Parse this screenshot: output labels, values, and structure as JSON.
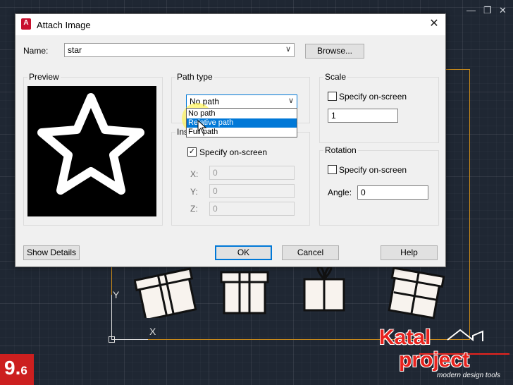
{
  "window": {
    "title": "Attach Image"
  },
  "name_row": {
    "label": "Name:",
    "value": "star",
    "browse_label": "Browse..."
  },
  "preview": {
    "label": "Preview"
  },
  "path_type": {
    "label": "Path type",
    "selected": "No path",
    "options": [
      "No path",
      "Relative path",
      "Full path"
    ],
    "highlighted_index": 1
  },
  "insertion": {
    "label": "Insertion point",
    "specify_label": "Specify on-screen",
    "specify_checked": true,
    "x_label": "X:",
    "x_value": "0",
    "y_label": "Y:",
    "y_value": "0",
    "z_label": "Z:",
    "z_value": "0"
  },
  "scale": {
    "label": "Scale",
    "specify_label": "Specify on-screen",
    "specify_checked": false,
    "value": "1"
  },
  "rotation": {
    "label": "Rotation",
    "specify_label": "Specify on-screen",
    "specify_checked": false,
    "angle_label": "Angle:",
    "angle_value": "0"
  },
  "buttons": {
    "show_details": "Show Details",
    "ok": "OK",
    "cancel": "Cancel",
    "help": "Help"
  },
  "workspace": {
    "y_axis_label": "Y",
    "x_axis_label": "X"
  },
  "branding": {
    "name_top": "Katal",
    "name_bottom": "project",
    "tagline": "modern design tools",
    "badge_main": "9.",
    "badge_sub": "6"
  },
  "colors": {
    "accent": "#0078d7",
    "brand": "#e8231e",
    "frame": "#c98a1a"
  }
}
